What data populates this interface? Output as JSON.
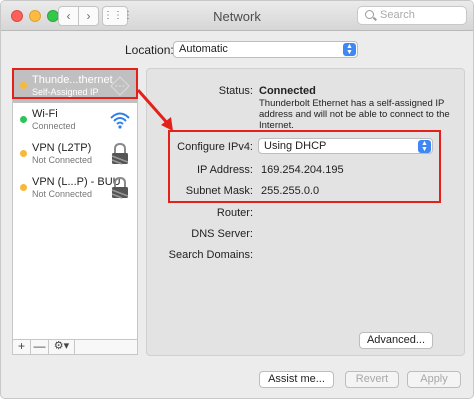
{
  "window": {
    "title": "Network"
  },
  "toolbar": {
    "back_glyph": "‹",
    "forward_glyph": "›",
    "grid_glyph": "⋮⋮⋮",
    "search_placeholder": "Search"
  },
  "location": {
    "label": "Location:",
    "value": "Automatic"
  },
  "services": [
    {
      "name": "Thunde...thernet",
      "sub": "Self-Assigned IP",
      "status_color": "#f5b93b",
      "icon": "ethernet-icon",
      "selected": true
    },
    {
      "name": "Wi-Fi",
      "sub": "Connected",
      "status_color": "#2fc45a",
      "icon": "wifi-icon"
    },
    {
      "name": "VPN (L2TP)",
      "sub": "Not Connected",
      "status_color": "#f5b93b",
      "icon": "lock-icon"
    },
    {
      "name": "VPN (L...P) - BUU",
      "sub": "Not Connected",
      "status_color": "#f5b93b",
      "icon": "lock-icon"
    }
  ],
  "sidebar_buttons": {
    "add": "+",
    "remove": "—",
    "gear": "⚙▾"
  },
  "details": {
    "status_label": "Status:",
    "status_value": "Connected",
    "status_desc": "Thunderbolt Ethernet has a self-assigned IP address and will not be able to connect to the Internet.",
    "configure_label": "Configure IPv4:",
    "configure_value": "Using DHCP",
    "ip_label": "IP Address:",
    "ip_value": "169.254.204.195",
    "subnet_label": "Subnet Mask:",
    "subnet_value": "255.255.0.0",
    "router_label": "Router:",
    "dns_label": "DNS Server:",
    "search_domains_label": "Search Domains:",
    "advanced_label": "Advanced..."
  },
  "footer": {
    "assist_label": "Assist me...",
    "revert_label": "Revert",
    "apply_label": "Apply"
  },
  "colors": {
    "accent": "#3f87f5",
    "annotation_red": "#e3211a",
    "connected_green": "#2fc45a",
    "warning_yellow": "#f5b93b"
  }
}
